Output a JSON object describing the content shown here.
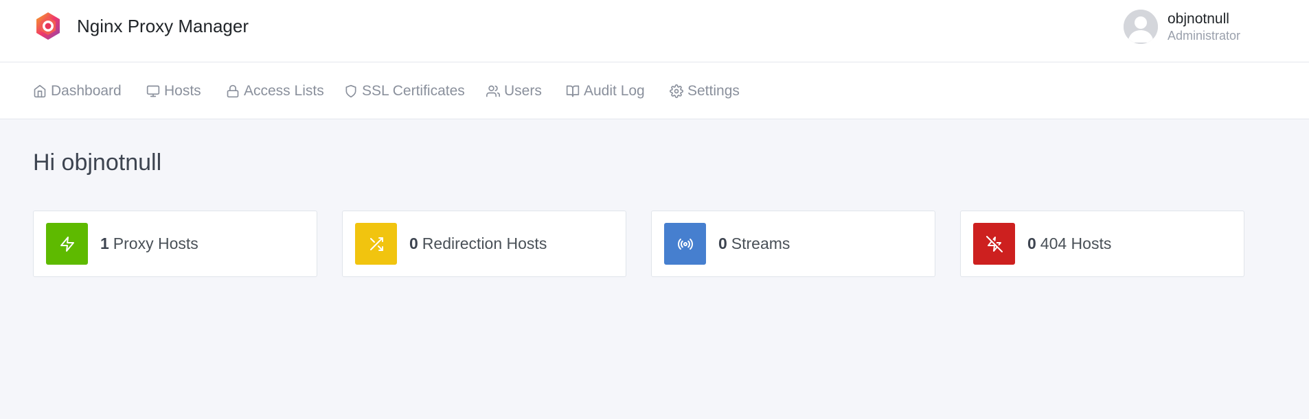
{
  "app": {
    "name": "Nginx Proxy Manager"
  },
  "user": {
    "name": "objnotnull",
    "role": "Administrator"
  },
  "nav": {
    "items": [
      {
        "label": "Dashboard",
        "icon": "home-icon"
      },
      {
        "label": "Hosts",
        "icon": "monitor-icon"
      },
      {
        "label": "Access Lists",
        "icon": "lock-icon"
      },
      {
        "label": "SSL Certificates",
        "icon": "shield-icon"
      },
      {
        "label": "Users",
        "icon": "users-icon"
      },
      {
        "label": "Audit Log",
        "icon": "book-icon"
      },
      {
        "label": "Settings",
        "icon": "gear-icon"
      }
    ]
  },
  "main": {
    "greeting": "Hi objnotnull",
    "cards": [
      {
        "count": "1",
        "label": "Proxy Hosts",
        "icon": "zap-icon",
        "color": "#5eba00"
      },
      {
        "count": "0",
        "label": "Redirection Hosts",
        "icon": "shuffle-icon",
        "color": "#f1c40f"
      },
      {
        "count": "0",
        "label": "Streams",
        "icon": "radio-icon",
        "color": "#467fcf"
      },
      {
        "count": "0",
        "label": "404 Hosts",
        "icon": "zap-off-icon",
        "color": "#cd201f"
      }
    ]
  }
}
